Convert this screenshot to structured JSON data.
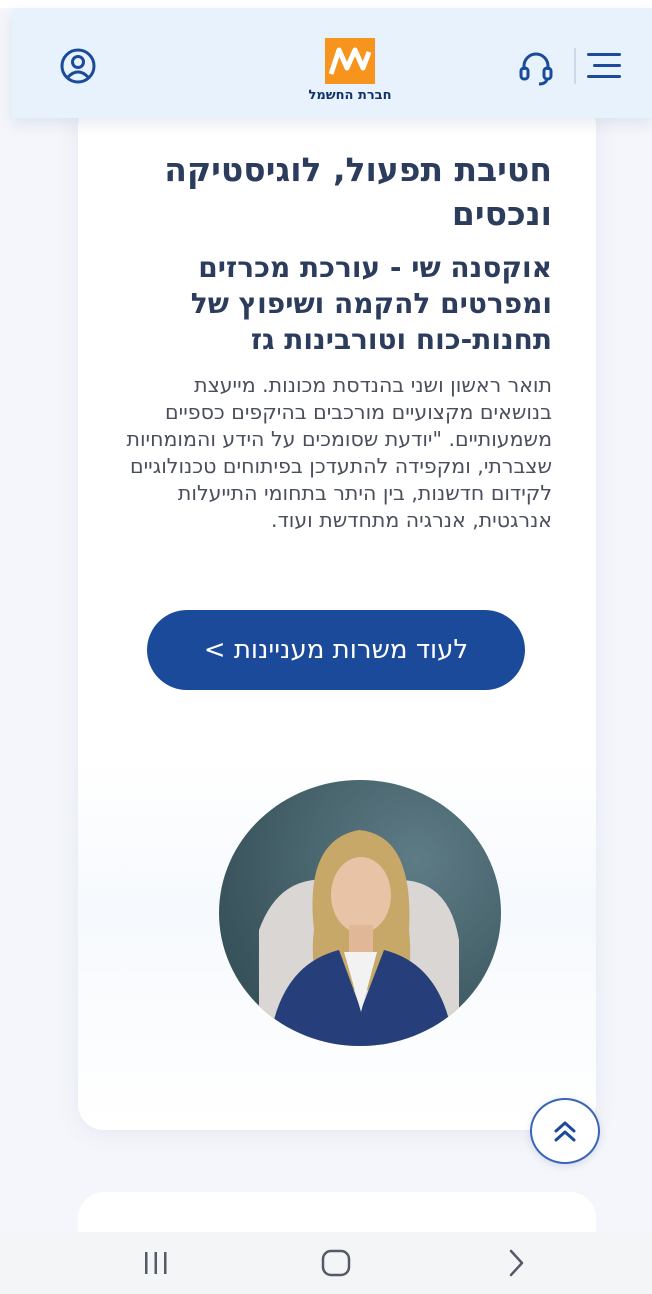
{
  "header": {
    "logo_text": "חברת החשמל",
    "icons": [
      "menu-icon",
      "headset-icon",
      "user-circle-icon"
    ],
    "logo_colors": {
      "orange": "#f7941d",
      "navy": "#13316b"
    },
    "background": "#e8f2fc"
  },
  "profile": {
    "department": "חטיבת תפעול, לוגיסטיקה ונכסים",
    "name_role": "אוקסנה שי - עורכת מכרזים ומפרטים להקמה ושיפוץ של תחנות-כוח וטורבינות גז",
    "bio": "תואר ראשון ושני בהנדסת מכונות. מייעצת בנושאים מקצועיים מורכבים בהיקפים כספיים משמעותיים. \"יודעת שסומכים על הידע והמומחיות שצברתי, ומקפידה להתעדכן בפיתוחים טכנולוגיים לקידום חדשנות, בין היתר בתחומי התייעלות אנרגטית, אנרגיה מתחדשת ועוד.",
    "cta_label": "לעוד משרות מעניינות >",
    "cta_color": "#1c4a9a"
  },
  "floating": {
    "scroll_top_icon": "double-chevron-up-icon"
  },
  "system_nav": {
    "icons": [
      "recents-icon",
      "home-icon",
      "back-icon"
    ]
  }
}
